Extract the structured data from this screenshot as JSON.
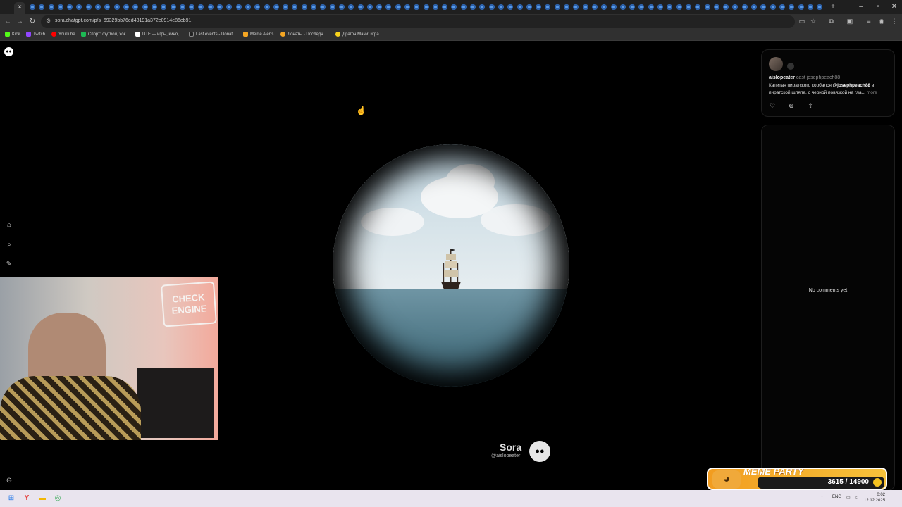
{
  "browser": {
    "active_tab_close": "×",
    "new_tab": "+",
    "window_controls": {
      "minimize": "–",
      "maximize": "▫",
      "close": "✕"
    },
    "nav": {
      "back": "←",
      "forward": "→",
      "reload": "↻"
    },
    "url": "sora.chatgpt.com/p/s_69329bb76ed48191a372e0914e86eb91",
    "bookmarks": [
      {
        "label": "Kick",
        "color": "#53fc18"
      },
      {
        "label": "Twitch",
        "color": "#9146ff"
      },
      {
        "label": "YouTube",
        "color": "#ff0000"
      },
      {
        "label": "Спорт: футбол, хок...",
        "color": "#1db954"
      },
      {
        "label": "DTF — игры, кино,...",
        "color": "#ffffff"
      },
      {
        "label": "Last events - Donat...",
        "color": "#222222"
      },
      {
        "label": "Meme Alerts",
        "color": "#f5a623"
      },
      {
        "label": "Донаты - Последн...",
        "color": "#f5a623"
      },
      {
        "label": "Драгон Мани: игра...",
        "color": "#f7d21c"
      }
    ]
  },
  "post": {
    "author": "aislopeater",
    "cast_label": "cast josephpeach88",
    "caption_before": "Капитан пиратского корбался ",
    "mention": "@josephpeach88",
    "caption_after": " в пиратской шляпе, с черной повязкой на гла...",
    "more": "more"
  },
  "comments": {
    "empty_text": "No comments yet"
  },
  "watermark": {
    "name": "Sora",
    "handle": "@aislopeater"
  },
  "webcam": {
    "sign_text": "CHECK ENGINE"
  },
  "meme_party": {
    "title": "MEME PARTY",
    "progress": "3615 / 14900",
    "progress_fraction": 0.243
  },
  "taskbar": {
    "lang": "ENG",
    "time": "0:02",
    "date": "12.12.2025"
  }
}
